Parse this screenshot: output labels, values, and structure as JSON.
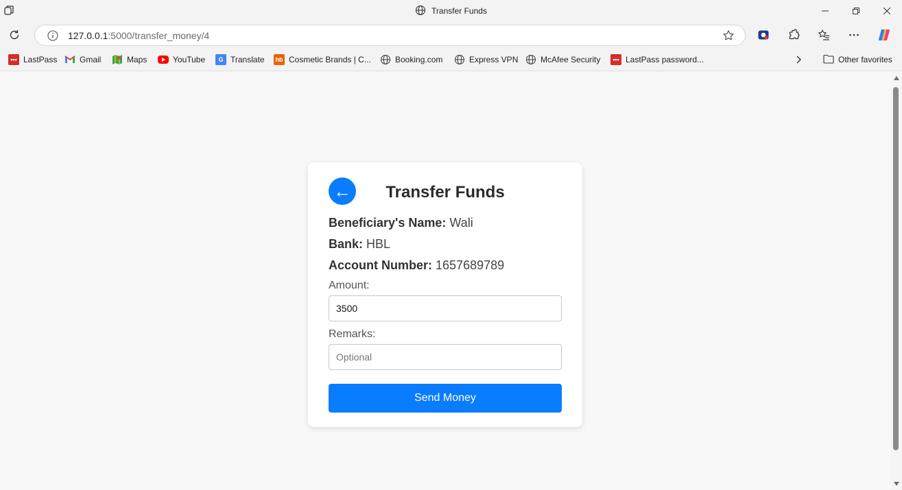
{
  "window": {
    "title": "Transfer Funds",
    "minimize_icon": "minimize-icon",
    "maximize_icon": "restore-icon",
    "close_icon": "close-icon"
  },
  "address_bar": {
    "url_host": "127.0.0.1",
    "url_rest": ":5000/transfer_money/4"
  },
  "favorites": [
    {
      "label": "LastPass",
      "icon": "lastpass-icon",
      "color": "#d32d27"
    },
    {
      "label": "Gmail",
      "icon": "gmail-icon",
      "color": "#ea4335"
    },
    {
      "label": "Maps",
      "icon": "maps-icon",
      "color": "#34a853"
    },
    {
      "label": "YouTube",
      "icon": "youtube-icon",
      "color": "#ff0000"
    },
    {
      "label": "Translate",
      "icon": "translate-icon",
      "color": "#4285f4"
    },
    {
      "label": "Cosmetic Brands | C...",
      "icon": "hb-icon",
      "color": "#e8620c"
    },
    {
      "label": "Booking.com",
      "icon": "globe-icon",
      "color": "#444444"
    },
    {
      "label": "Express VPN",
      "icon": "globe-icon",
      "color": "#444444"
    },
    {
      "label": "McAfee Security",
      "icon": "globe-icon",
      "color": "#444444"
    },
    {
      "label": "LastPass password...",
      "icon": "lastpass-icon",
      "color": "#d32d27"
    }
  ],
  "other_favorites": "Other favorites",
  "form": {
    "title": "Transfer Funds",
    "beneficiary_label": "Beneficiary's Name:",
    "beneficiary_value": "Wali",
    "bank_label": "Bank:",
    "bank_value": "HBL",
    "account_label": "Account Number:",
    "account_value": "1657689789",
    "amount_label": "Amount:",
    "amount_value": "3500",
    "remarks_label": "Remarks:",
    "remarks_placeholder": "Optional",
    "send_label": "Send Money",
    "back_glyph": "←"
  },
  "colors": {
    "primary": "#0a7cff"
  }
}
